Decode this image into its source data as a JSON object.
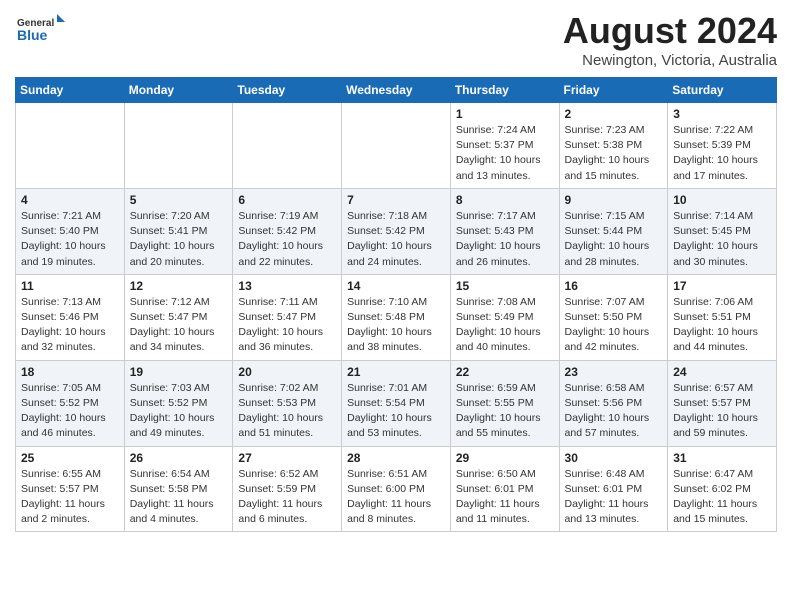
{
  "header": {
    "logo_line1": "General",
    "logo_line2": "Blue",
    "title": "August 2024",
    "subtitle": "Newington, Victoria, Australia"
  },
  "weekdays": [
    "Sunday",
    "Monday",
    "Tuesday",
    "Wednesday",
    "Thursday",
    "Friday",
    "Saturday"
  ],
  "weeks": [
    [
      {
        "day": "",
        "info": ""
      },
      {
        "day": "",
        "info": ""
      },
      {
        "day": "",
        "info": ""
      },
      {
        "day": "",
        "info": ""
      },
      {
        "day": "1",
        "info": "Sunrise: 7:24 AM\nSunset: 5:37 PM\nDaylight: 10 hours\nand 13 minutes."
      },
      {
        "day": "2",
        "info": "Sunrise: 7:23 AM\nSunset: 5:38 PM\nDaylight: 10 hours\nand 15 minutes."
      },
      {
        "day": "3",
        "info": "Sunrise: 7:22 AM\nSunset: 5:39 PM\nDaylight: 10 hours\nand 17 minutes."
      }
    ],
    [
      {
        "day": "4",
        "info": "Sunrise: 7:21 AM\nSunset: 5:40 PM\nDaylight: 10 hours\nand 19 minutes."
      },
      {
        "day": "5",
        "info": "Sunrise: 7:20 AM\nSunset: 5:41 PM\nDaylight: 10 hours\nand 20 minutes."
      },
      {
        "day": "6",
        "info": "Sunrise: 7:19 AM\nSunset: 5:42 PM\nDaylight: 10 hours\nand 22 minutes."
      },
      {
        "day": "7",
        "info": "Sunrise: 7:18 AM\nSunset: 5:42 PM\nDaylight: 10 hours\nand 24 minutes."
      },
      {
        "day": "8",
        "info": "Sunrise: 7:17 AM\nSunset: 5:43 PM\nDaylight: 10 hours\nand 26 minutes."
      },
      {
        "day": "9",
        "info": "Sunrise: 7:15 AM\nSunset: 5:44 PM\nDaylight: 10 hours\nand 28 minutes."
      },
      {
        "day": "10",
        "info": "Sunrise: 7:14 AM\nSunset: 5:45 PM\nDaylight: 10 hours\nand 30 minutes."
      }
    ],
    [
      {
        "day": "11",
        "info": "Sunrise: 7:13 AM\nSunset: 5:46 PM\nDaylight: 10 hours\nand 32 minutes."
      },
      {
        "day": "12",
        "info": "Sunrise: 7:12 AM\nSunset: 5:47 PM\nDaylight: 10 hours\nand 34 minutes."
      },
      {
        "day": "13",
        "info": "Sunrise: 7:11 AM\nSunset: 5:47 PM\nDaylight: 10 hours\nand 36 minutes."
      },
      {
        "day": "14",
        "info": "Sunrise: 7:10 AM\nSunset: 5:48 PM\nDaylight: 10 hours\nand 38 minutes."
      },
      {
        "day": "15",
        "info": "Sunrise: 7:08 AM\nSunset: 5:49 PM\nDaylight: 10 hours\nand 40 minutes."
      },
      {
        "day": "16",
        "info": "Sunrise: 7:07 AM\nSunset: 5:50 PM\nDaylight: 10 hours\nand 42 minutes."
      },
      {
        "day": "17",
        "info": "Sunrise: 7:06 AM\nSunset: 5:51 PM\nDaylight: 10 hours\nand 44 minutes."
      }
    ],
    [
      {
        "day": "18",
        "info": "Sunrise: 7:05 AM\nSunset: 5:52 PM\nDaylight: 10 hours\nand 46 minutes."
      },
      {
        "day": "19",
        "info": "Sunrise: 7:03 AM\nSunset: 5:52 PM\nDaylight: 10 hours\nand 49 minutes."
      },
      {
        "day": "20",
        "info": "Sunrise: 7:02 AM\nSunset: 5:53 PM\nDaylight: 10 hours\nand 51 minutes."
      },
      {
        "day": "21",
        "info": "Sunrise: 7:01 AM\nSunset: 5:54 PM\nDaylight: 10 hours\nand 53 minutes."
      },
      {
        "day": "22",
        "info": "Sunrise: 6:59 AM\nSunset: 5:55 PM\nDaylight: 10 hours\nand 55 minutes."
      },
      {
        "day": "23",
        "info": "Sunrise: 6:58 AM\nSunset: 5:56 PM\nDaylight: 10 hours\nand 57 minutes."
      },
      {
        "day": "24",
        "info": "Sunrise: 6:57 AM\nSunset: 5:57 PM\nDaylight: 10 hours\nand 59 minutes."
      }
    ],
    [
      {
        "day": "25",
        "info": "Sunrise: 6:55 AM\nSunset: 5:57 PM\nDaylight: 11 hours\nand 2 minutes."
      },
      {
        "day": "26",
        "info": "Sunrise: 6:54 AM\nSunset: 5:58 PM\nDaylight: 11 hours\nand 4 minutes."
      },
      {
        "day": "27",
        "info": "Sunrise: 6:52 AM\nSunset: 5:59 PM\nDaylight: 11 hours\nand 6 minutes."
      },
      {
        "day": "28",
        "info": "Sunrise: 6:51 AM\nSunset: 6:00 PM\nDaylight: 11 hours\nand 8 minutes."
      },
      {
        "day": "29",
        "info": "Sunrise: 6:50 AM\nSunset: 6:01 PM\nDaylight: 11 hours\nand 11 minutes."
      },
      {
        "day": "30",
        "info": "Sunrise: 6:48 AM\nSunset: 6:01 PM\nDaylight: 11 hours\nand 13 minutes."
      },
      {
        "day": "31",
        "info": "Sunrise: 6:47 AM\nSunset: 6:02 PM\nDaylight: 11 hours\nand 15 minutes."
      }
    ]
  ]
}
